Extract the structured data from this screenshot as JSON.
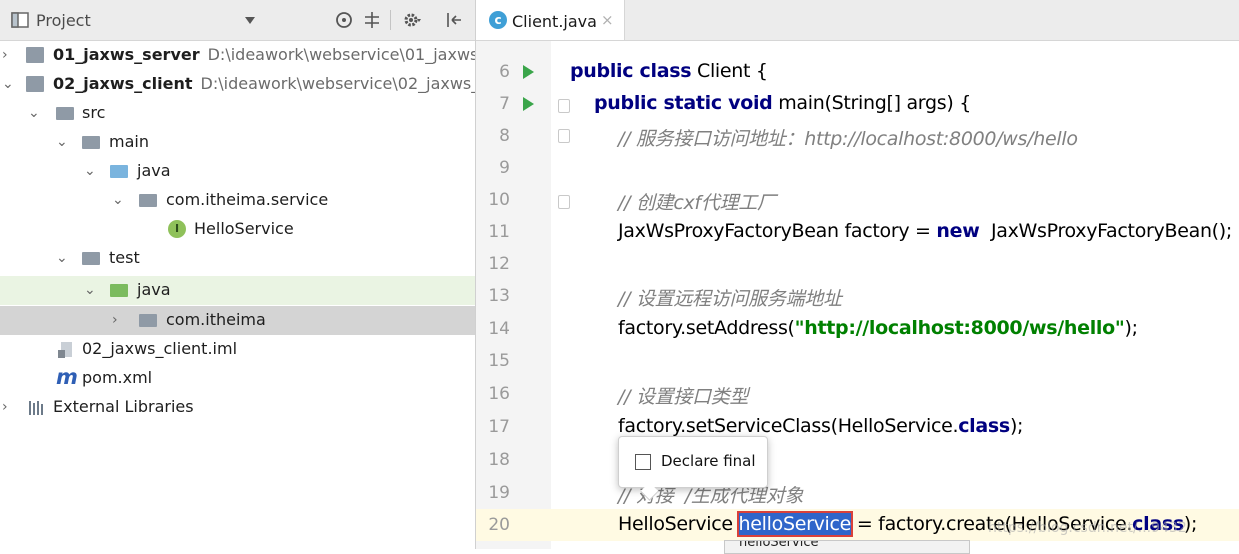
{
  "project_panel": {
    "title": "Project",
    "items": [
      {
        "label": "01_jaxws_server",
        "path": "D:\\ideawork\\webservice\\01_jaxws_"
      },
      {
        "label": "02_jaxws_client",
        "path": "D:\\ideawork\\webservice\\02_jaxws_"
      },
      {
        "label": "src"
      },
      {
        "label": "main"
      },
      {
        "label": "java"
      },
      {
        "label": "com.itheima.service"
      },
      {
        "label": "HelloService",
        "icon_letter": "I"
      },
      {
        "label": "test"
      },
      {
        "label": "java"
      },
      {
        "label": "com.itheima"
      },
      {
        "label": "02_jaxws_client.iml"
      },
      {
        "label": "pom.xml",
        "icon_letter": "m"
      },
      {
        "label": "External Libraries"
      }
    ]
  },
  "editor": {
    "tab": {
      "label": "Client.java",
      "icon_letter": "c",
      "close": "×"
    },
    "lines": [
      {
        "n": "6"
      },
      {
        "n": "7"
      },
      {
        "n": "8",
        "text": "// 服务接口访问地址：http://localhost:8000/ws/hello"
      },
      {
        "n": "9"
      },
      {
        "n": "10",
        "text": "// 创建cxf代理工厂"
      },
      {
        "n": "11",
        "a": "JaxWsProxyFactoryBean factory = ",
        "b": "new",
        "c": "  JaxWsProxyFactoryBean();"
      },
      {
        "n": "12"
      },
      {
        "n": "13",
        "text": "// 设置远程访问服务端地址"
      },
      {
        "n": "14",
        "a": "factory.setAddress(",
        "b": "\"http://localhost:8000/ws/hello\"",
        "c": ");"
      },
      {
        "n": "15"
      },
      {
        "n": "16",
        "text": "// 设置接口类型"
      },
      {
        "n": "17",
        "a": "factory.setServiceClass(HelloService.",
        "b": "class",
        "c": ");"
      },
      {
        "n": "18"
      },
      {
        "n": "19",
        "text": "// 对接  /生成代理对象"
      },
      {
        "n": "20",
        "a": "HelloService ",
        "b": "helloService",
        "c": " = factory.create(HelloService.",
        "d": "class",
        "e": ");"
      }
    ],
    "line6": {
      "kw": "public class",
      "rest": " Client {"
    },
    "line7": {
      "kw": "public static void",
      "rest": " main(String[] args) {"
    }
  },
  "popup": {
    "label": "Declare final"
  },
  "autocomplete": {
    "text": "helloService"
  },
  "watermark": "https://blog.csdn.net/...9432",
  "colors": {
    "accent": "#2f65ca",
    "keyword": "#000080",
    "string": "#008000",
    "comment": "#808080"
  }
}
